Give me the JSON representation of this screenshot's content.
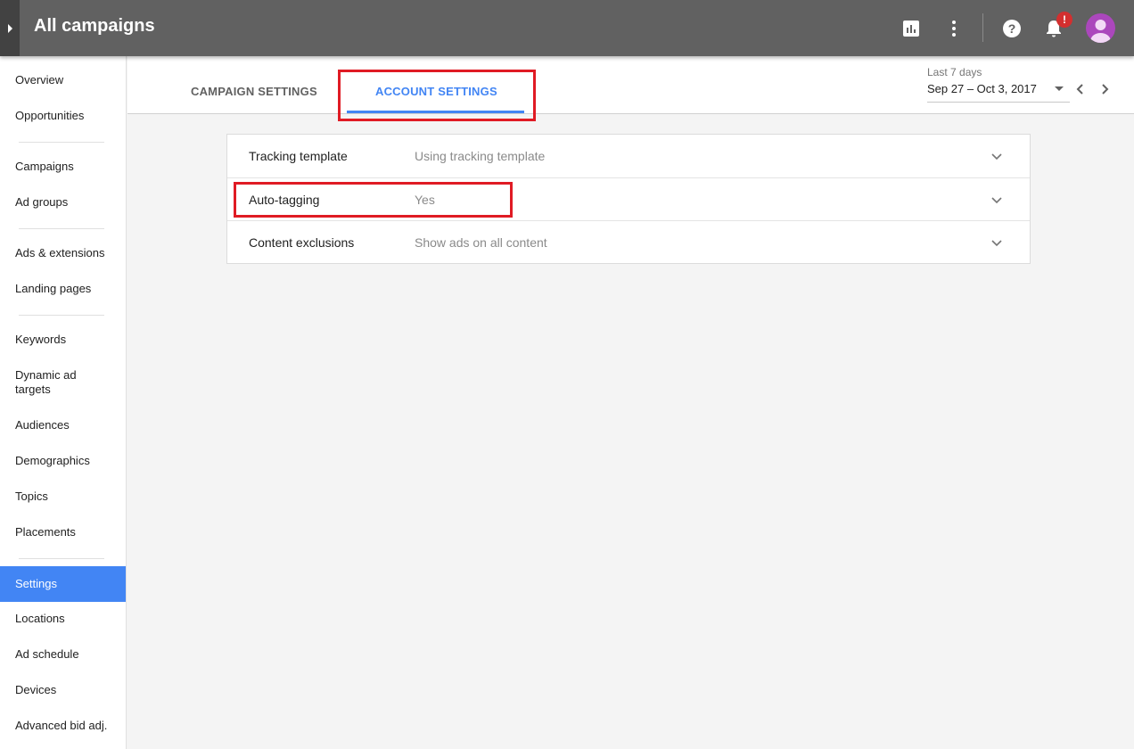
{
  "header": {
    "title": "All campaigns",
    "notification_badge": "!",
    "icons": [
      "expand-icon",
      "reports-icon",
      "more-vert-icon",
      "help-icon",
      "notifications-icon",
      "avatar"
    ]
  },
  "sidebar": {
    "items": [
      {
        "label": "Overview"
      },
      {
        "label": "Opportunities"
      },
      {
        "label": "Campaigns"
      },
      {
        "label": "Ad groups"
      },
      {
        "label": "Ads & extensions"
      },
      {
        "label": "Landing pages"
      },
      {
        "label": "Keywords"
      },
      {
        "label": "Dynamic ad targets"
      },
      {
        "label": "Audiences"
      },
      {
        "label": "Demographics"
      },
      {
        "label": "Topics"
      },
      {
        "label": "Placements"
      },
      {
        "label": "Settings",
        "active": true
      },
      {
        "label": "Locations"
      },
      {
        "label": "Ad schedule"
      },
      {
        "label": "Devices"
      },
      {
        "label": "Advanced bid adj."
      }
    ]
  },
  "tabs": [
    {
      "label": "CAMPAIGN SETTINGS",
      "active": false
    },
    {
      "label": "ACCOUNT SETTINGS",
      "active": true
    }
  ],
  "date_range": {
    "label": "Last 7 days",
    "value": "Sep 27 – Oct 3, 2017"
  },
  "settings": {
    "rows": [
      {
        "label": "Tracking template",
        "value": "Using tracking template"
      },
      {
        "label": "Auto-tagging",
        "value": "Yes"
      },
      {
        "label": "Content exclusions",
        "value": "Show ads on all content"
      }
    ]
  },
  "colors": {
    "topbar": "#616161",
    "accent": "#4285f4",
    "highlight": "#e01b24",
    "avatar": "#ab47bc",
    "badge": "#d32f2f"
  }
}
